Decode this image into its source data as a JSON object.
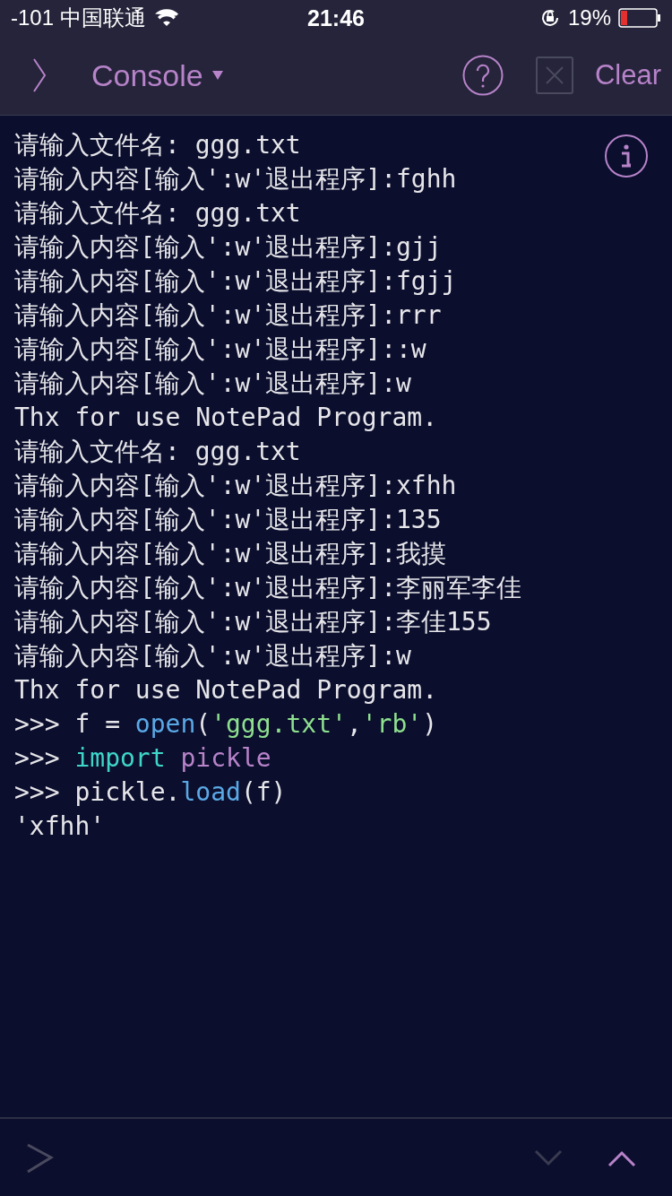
{
  "status_bar": {
    "carrier": "-101 中国联通",
    "time": "21:46",
    "battery_text": "19%"
  },
  "nav_bar": {
    "title": "Console",
    "clear_disabled": true,
    "clear_label": "Clear"
  },
  "console": {
    "lines": [
      [
        {
          "text": "请输入文件名: ggg.txt",
          "kind": "plain"
        }
      ],
      [
        {
          "text": "请输入内容[输入':w'退出程序]:fghh",
          "kind": "plain"
        }
      ],
      [
        {
          "text": "请输入文件名: ggg.txt",
          "kind": "plain"
        }
      ],
      [
        {
          "text": "请输入内容[输入':w'退出程序]:gjj",
          "kind": "plain"
        }
      ],
      [
        {
          "text": "请输入内容[输入':w'退出程序]:fgjj",
          "kind": "plain"
        }
      ],
      [
        {
          "text": "请输入内容[输入':w'退出程序]:rrr",
          "kind": "plain"
        }
      ],
      [
        {
          "text": "请输入内容[输入':w'退出程序]::w",
          "kind": "plain"
        }
      ],
      [
        {
          "text": "请输入内容[输入':w'退出程序]:w",
          "kind": "plain"
        }
      ],
      [
        {
          "text": "Thx for use NotePad Program.",
          "kind": "plain"
        }
      ],
      [
        {
          "text": "请输入文件名: ggg.txt",
          "kind": "plain"
        }
      ],
      [
        {
          "text": "请输入内容[输入':w'退出程序]:xfhh",
          "kind": "plain"
        }
      ],
      [
        {
          "text": "请输入内容[输入':w'退出程序]:135",
          "kind": "plain"
        }
      ],
      [
        {
          "text": "请输入内容[输入':w'退出程序]:我摸",
          "kind": "plain"
        }
      ],
      [
        {
          "text": "请输入内容[输入':w'退出程序]:李丽军李佳",
          "kind": "plain"
        }
      ],
      [
        {
          "text": "请输入内容[输入':w'退出程序]:李佳155",
          "kind": "plain"
        }
      ],
      [
        {
          "text": "请输入内容[输入':w'退出程序]:w",
          "kind": "plain"
        }
      ],
      [
        {
          "text": "Thx for use NotePad Program.",
          "kind": "plain"
        }
      ],
      [
        {
          "text": ">>> f = ",
          "kind": "plain"
        },
        {
          "text": "open",
          "kind": "function"
        },
        {
          "text": "(",
          "kind": "plain"
        },
        {
          "text": "'ggg.txt'",
          "kind": "string"
        },
        {
          "text": ",",
          "kind": "plain"
        },
        {
          "text": "'rb'",
          "kind": "string"
        },
        {
          "text": ")",
          "kind": "plain"
        }
      ],
      [
        {
          "text": ">>> ",
          "kind": "plain"
        },
        {
          "text": "import",
          "kind": "keyword"
        },
        {
          "text": " pickle",
          "kind": "module"
        }
      ],
      [
        {
          "text": ">>> pickle.",
          "kind": "plain"
        },
        {
          "text": "load",
          "kind": "function"
        },
        {
          "text": "(f)",
          "kind": "plain"
        }
      ],
      [
        {
          "text": "'xfhh'",
          "kind": "plain"
        }
      ]
    ]
  },
  "bottom_bar": {
    "history_down_disabled": true,
    "history_up_disabled": false
  }
}
